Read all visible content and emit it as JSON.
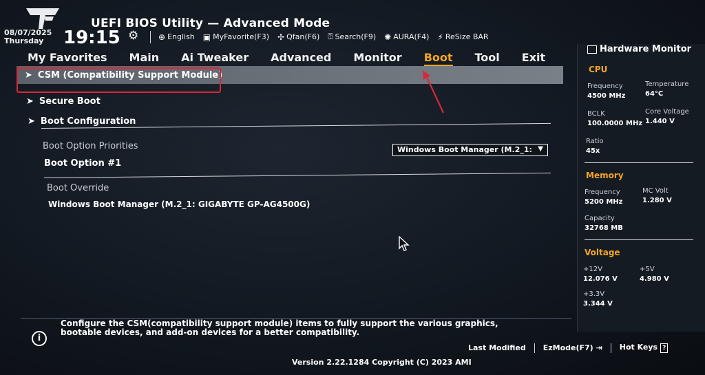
{
  "header": {
    "title": "UEFI BIOS Utility — Advanced Mode",
    "date": "08/07/2025",
    "day": "Thursday",
    "time": "19:15"
  },
  "toolbar": [
    {
      "icon": "globe-icon",
      "label": "English"
    },
    {
      "icon": "favorite-icon",
      "label": "MyFavorite(F3)"
    },
    {
      "icon": "fan-icon",
      "label": "Qfan(F6)"
    },
    {
      "icon": "search-icon",
      "label": "Search(F9)"
    },
    {
      "icon": "aura-icon",
      "label": "AURA(F4)"
    },
    {
      "icon": "resize-bar-icon",
      "label": "ReSize BAR"
    }
  ],
  "tabs": [
    "My Favorites",
    "Main",
    "Ai Tweaker",
    "Advanced",
    "Monitor",
    "Boot",
    "Tool",
    "Exit"
  ],
  "active_tab": "Boot",
  "menu": {
    "csm": "CSM (Compatibility Support Module)",
    "secure_boot": "Secure Boot",
    "boot_configuration": "Boot Configuration",
    "boot_option_priorities": "Boot Option Priorities",
    "boot_option_1_label": "Boot Option #1",
    "boot_option_1_value": "Windows Boot Manager (M.2_1:",
    "boot_override": "Boot Override",
    "boot_override_item": "Windows Boot Manager (M.2_1: GIGABYTE GP-AG4500G)"
  },
  "help": {
    "text": "Configure the CSM(compatibility support module) items to fully support the various graphics, bootable devices, and add-on devices for a better compatibility."
  },
  "footer": {
    "last_modified": "Last Modified",
    "ezmode": "EzMode(F7)",
    "hotkeys": "Hot Keys",
    "hotkeys_key": "?",
    "version": "Version 2.22.1284 Copyright (C) 2023 AMI"
  },
  "hardware_monitor": {
    "title": "Hardware Monitor",
    "cpu": {
      "heading": "CPU",
      "frequency_label": "Frequency",
      "frequency": "4500 MHz",
      "temperature_label": "Temperature",
      "temperature": "64°C",
      "bclk_label": "BCLK",
      "bclk": "100.0000 MHz",
      "core_voltage_label": "Core Voltage",
      "core_voltage": "1.440 V",
      "ratio_label": "Ratio",
      "ratio": "45x"
    },
    "memory": {
      "heading": "Memory",
      "frequency_label": "Frequency",
      "frequency": "5200 MHz",
      "mc_volt_label": "MC Volt",
      "mc_volt": "1.280 V",
      "capacity_label": "Capacity",
      "capacity": "32768 MB"
    },
    "voltage": {
      "heading": "Voltage",
      "v12_label": "+12V",
      "v12": "12.076 V",
      "v5_label": "+5V",
      "v5": "4.980 V",
      "v33_label": "+3.3V",
      "v33": "3.344 V"
    }
  },
  "colors": {
    "accent": "#f5a623",
    "highlight_box": "#d9283a"
  }
}
